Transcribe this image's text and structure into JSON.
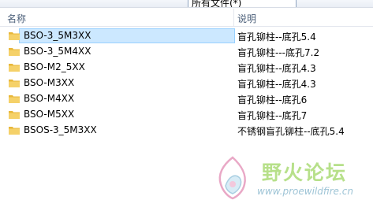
{
  "toolbar": {
    "frag_1": "",
    "frag_2": "",
    "frag_3": "",
    "frag_4": "",
    "box": "所有文件(*)",
    "frag_5": ""
  },
  "columns": {
    "name": "名称",
    "description": "说明"
  },
  "files": [
    {
      "name": "BSO-3_5M3XX",
      "desc": "盲孔铆柱--底孔5.4",
      "selected": true
    },
    {
      "name": "BSO-3_5M4XX",
      "desc": "盲孔铆柱---底孔7.2"
    },
    {
      "name": "BSO-M2_5XX",
      "desc": "盲孔铆柱--底孔4.3"
    },
    {
      "name": "BSO-M3XX",
      "desc": "盲孔铆柱--底孔4.3"
    },
    {
      "name": "BSO-M4XX",
      "desc": "盲孔铆柱--底孔6"
    },
    {
      "name": "BSO-M5XX",
      "desc": "盲孔铆柱--底孔7"
    },
    {
      "name": "BSOS-3_5M3XX",
      "desc": "不锈钢盲孔铆柱--底孔5.4"
    }
  ],
  "watermark": {
    "title": "野火论坛",
    "url": "www.proewildfire.cn"
  },
  "colors": {
    "selection_bg": "#cce8ff",
    "selection_border": "#99d1ff",
    "folder": "#f2c94c"
  }
}
